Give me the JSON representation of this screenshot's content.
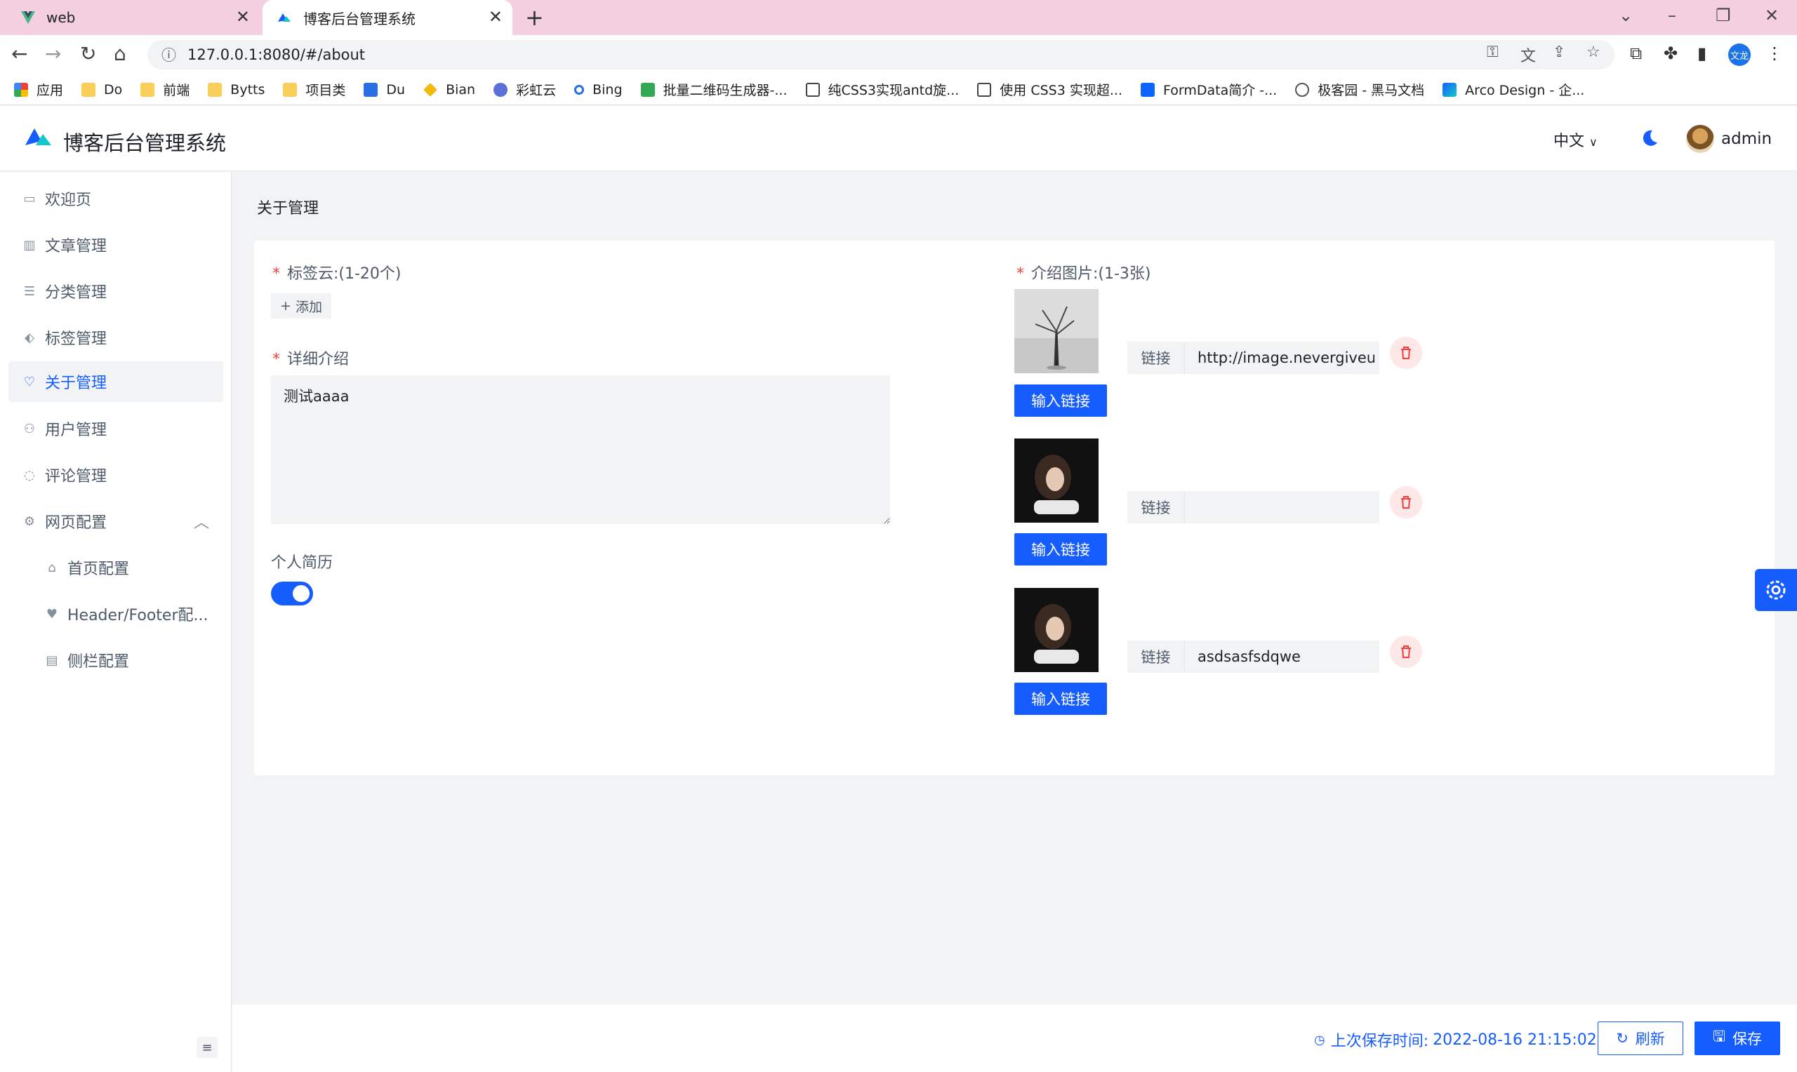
{
  "browser": {
    "tabs": [
      {
        "title": "web"
      },
      {
        "title": "博客后台管理系统"
      }
    ],
    "url": "127.0.0.1:8080/#/about",
    "profile_initials": "文龙",
    "bookmarks": [
      "应用",
      "Do",
      "前端",
      "Bytts",
      "项目类",
      "Du",
      "Bian",
      "彩虹云",
      "Bing",
      "批量二维码生成器-...",
      "纯CSS3实现antd旋...",
      "使用 CSS3 实现超...",
      "FormData简介 -...",
      "极客园 - 黑马文档",
      "Arco Design - 企..."
    ]
  },
  "header": {
    "title": "博客后台管理系统",
    "language": "中文",
    "username": "admin"
  },
  "sidebar": {
    "items": [
      {
        "label": "欢迎页"
      },
      {
        "label": "文章管理"
      },
      {
        "label": "分类管理"
      },
      {
        "label": "标签管理"
      },
      {
        "label": "关于管理"
      },
      {
        "label": "用户管理"
      },
      {
        "label": "评论管理"
      },
      {
        "label": "网页配置"
      },
      {
        "label": "首页配置"
      },
      {
        "label": "Header/Footer配..."
      },
      {
        "label": "侧栏配置"
      }
    ]
  },
  "main": {
    "breadcrumb": "关于管理",
    "tag_cloud_label": "标签云:(1-20个)",
    "add_label": "添加",
    "detail_label": "详细介绍",
    "detail_value": "测试aaaa",
    "resume_label": "个人简历",
    "resume_enabled": true,
    "images_label": "介绍图片:(1-3张)",
    "images": [
      {
        "link_prefix": "链接",
        "link_value": "http://image.nevergiveup",
        "button": "输入链接"
      },
      {
        "link_prefix": "链接",
        "link_value": "",
        "button": "输入链接"
      },
      {
        "link_prefix": "链接",
        "link_value": "asdsasfsdqwe",
        "button": "输入链接"
      }
    ]
  },
  "footer": {
    "save_time_label": "上次保存时间:",
    "save_time": "2022-08-16 21:15:02",
    "refresh_label": "刷新",
    "save_label": "保存"
  },
  "colors": {
    "primary": "#165dff",
    "danger": "#f53f3f",
    "tab_strip": "#f4cfe0"
  }
}
